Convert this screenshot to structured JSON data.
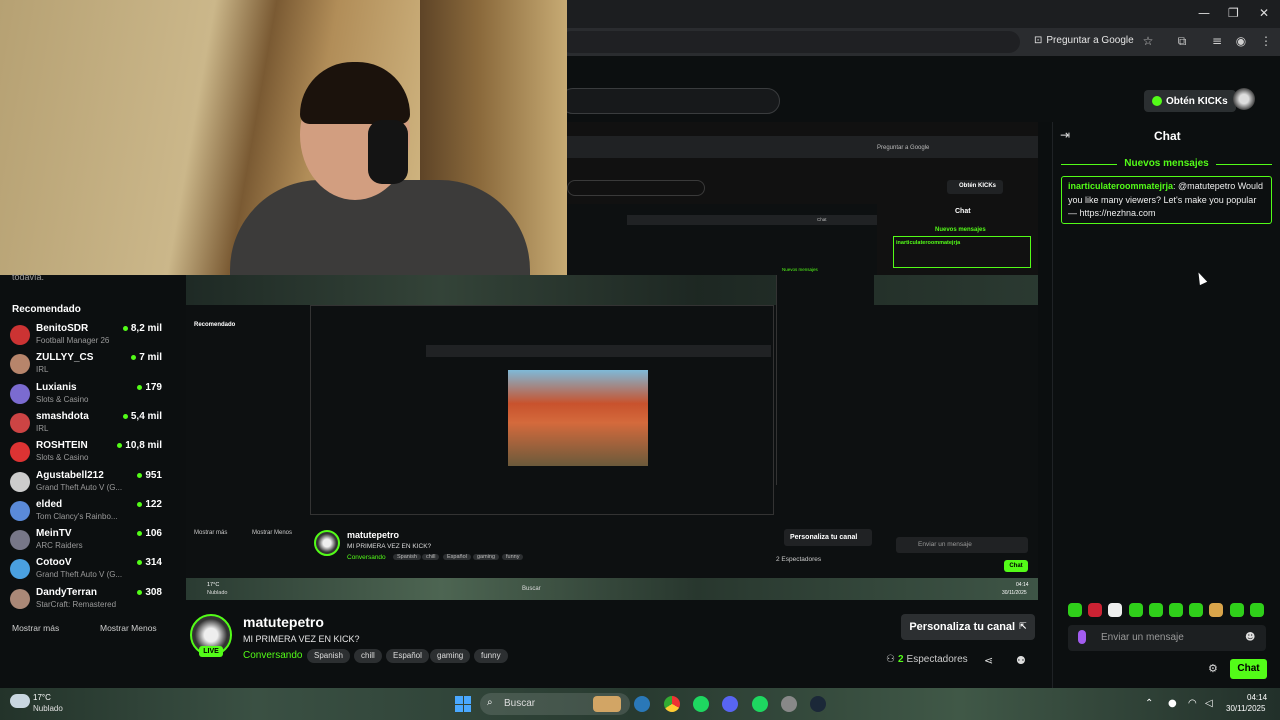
{
  "browser": {
    "ask_google": "Preguntar a Google",
    "window_controls": [
      "—",
      "❐",
      "✕"
    ]
  },
  "kick_header": {
    "get_kicks": "Obtén KICKs"
  },
  "sidebar": {
    "truncated_text": "todavía.",
    "title": "Recomendado",
    "channels": [
      {
        "name": "BenitoSDR",
        "category": "Football Manager 26",
        "viewers": "8,2 mil",
        "color": "#c33"
      },
      {
        "name": "ZULLYY_CS",
        "category": "IRL",
        "viewers": "7 mil",
        "color": "#b7856b"
      },
      {
        "name": "Luxianis",
        "category": "Slots & Casino",
        "viewers": "179",
        "color": "#7b6bd0"
      },
      {
        "name": "smashdota",
        "category": "IRL",
        "viewers": "5,4 mil",
        "color": "#c44"
      },
      {
        "name": "ROSHTEIN",
        "category": "Slots & Casino",
        "viewers": "10,8 mil",
        "color": "#d33"
      },
      {
        "name": "Agustabell212",
        "category": "Grand Theft Auto V (G...",
        "viewers": "951",
        "color": "#ccc"
      },
      {
        "name": "elded",
        "category": "Tom Clancy's Rainbo...",
        "viewers": "122",
        "color": "#5a8ad8"
      },
      {
        "name": "MeinTV",
        "category": "ARC Raiders",
        "viewers": "106",
        "color": "#778"
      },
      {
        "name": "CotooV",
        "category": "Grand Theft Auto V (G...",
        "viewers": "314",
        "color": "#4aa0e0"
      },
      {
        "name": "DandyTerran",
        "category": "StarCraft: Remastered",
        "viewers": "308",
        "color": "#a87"
      }
    ],
    "show_more": "Mostrar más",
    "show_less": "Mostrar Menos"
  },
  "channel": {
    "name": "matutepetro",
    "live": "LIVE",
    "title": "MI PRIMERA VEZ EN KICK?",
    "category": "Conversando",
    "tags": [
      "Spanish",
      "chill",
      "Español",
      "gaming",
      "funny"
    ],
    "customize": "Personaliza tu canal",
    "viewer_count": "2",
    "viewer_label": "Espectadores"
  },
  "chat": {
    "title": "Chat",
    "new_messages": "Nuevos mensajes",
    "message": {
      "user": "inarticulateroommatejrja",
      "text": ": @matutepetro Would you like many viewers? Let's make you popular — https://nezhna.com"
    },
    "input_placeholder": "Enviar un mensaje",
    "send": "Chat"
  },
  "nested": {
    "ask_google": "Preguntar a Google",
    "get_kicks": "Obtén KICKs",
    "chat_title": "Chat",
    "new_messages": "Nuevos mensajes",
    "msg_user": "inarticulateroommatejrja",
    "msg_text": ": @matutepetro Would you like many viewers? Let's make you popular — https://nezhna.com",
    "recommended": "Recomendado",
    "show_more": "Mostrar más",
    "show_less": "Mostrar Menos",
    "channel_name": "matutepetro",
    "channel_title": "MI PRIMERA VEZ EN KICK?",
    "category": "Conversando",
    "tags": [
      "Spanish",
      "chill",
      "Español",
      "gaming",
      "funny"
    ],
    "customize": "Personaliza tu canal",
    "viewers": "2 Espectadores",
    "input_placeholder": "Enviar un mensaje",
    "send": "Chat",
    "taskbar_search": "Buscar",
    "temp": "17°C",
    "weather": "Nublado",
    "time": "04:14",
    "date": "30/11/2025",
    "inner_chat_title": "Chat",
    "inner_new_messages": "Nuevos mensajes"
  },
  "taskbar": {
    "temperature": "17°C",
    "weather": "Nublado",
    "search": "Buscar",
    "time": "04:14",
    "date": "30/11/2025"
  }
}
